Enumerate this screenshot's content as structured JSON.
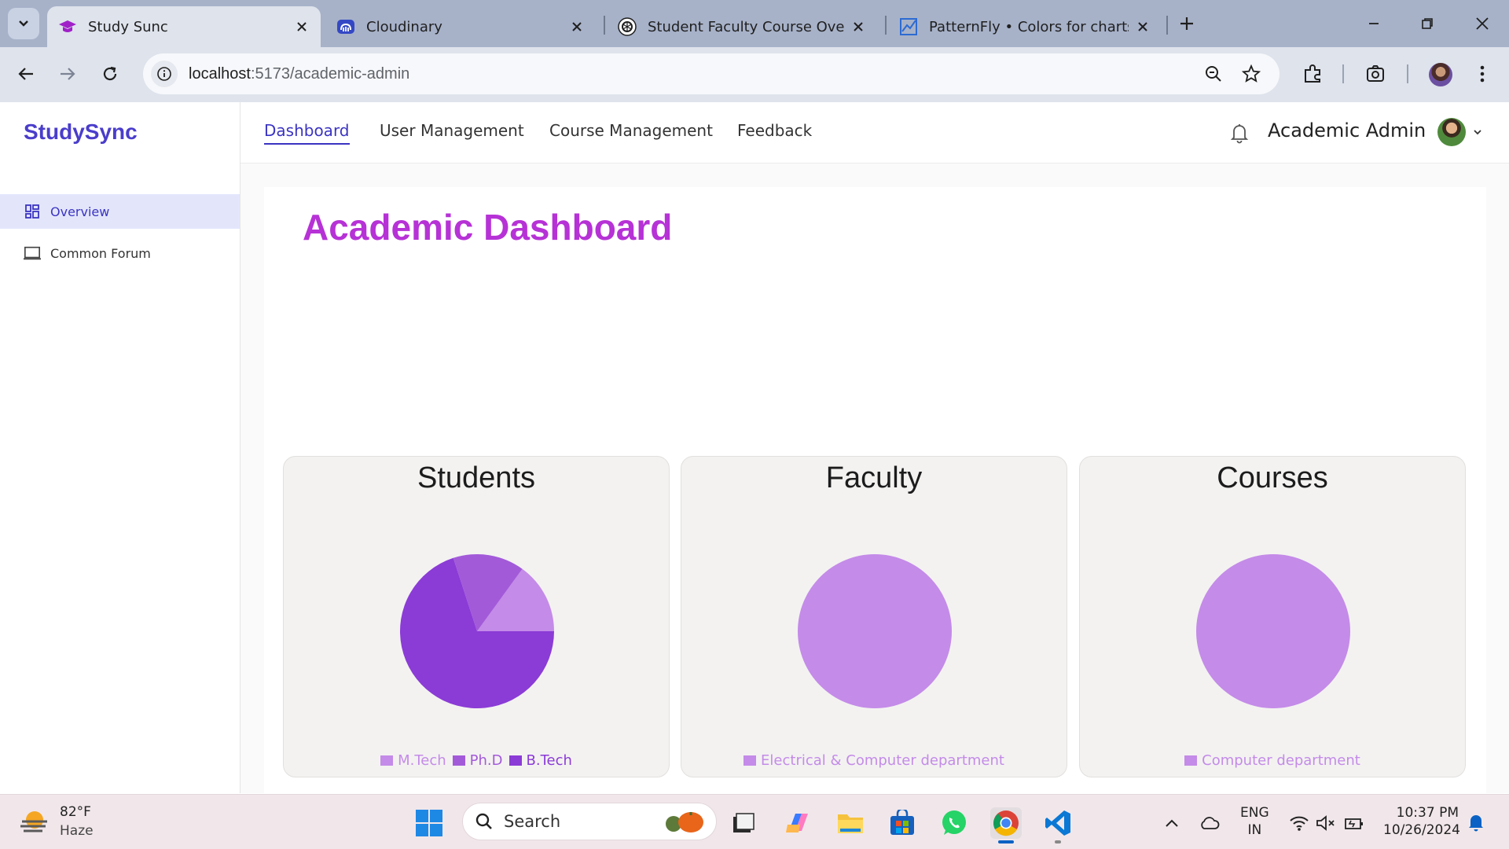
{
  "browser": {
    "tabs": [
      {
        "title": "Study Sunc",
        "active": true
      },
      {
        "title": "Cloudinary",
        "active": false
      },
      {
        "title": "Student Faculty Course Overview",
        "active": false
      },
      {
        "title": "PatternFly • Colors for charts",
        "active": false
      }
    ],
    "url_host": "localhost",
    "url_path": ":5173/academic-admin"
  },
  "app": {
    "brand": "StudySync",
    "sidebar": {
      "items": [
        {
          "label": "Overview",
          "icon": "dashboard-grid-icon",
          "active": true
        },
        {
          "label": "Common Forum",
          "icon": "laptop-icon",
          "active": false
        }
      ]
    },
    "topnav": {
      "links": [
        {
          "label": "Dashboard",
          "active": true
        },
        {
          "label": "User Management",
          "active": false
        },
        {
          "label": "Course Management",
          "active": false
        },
        {
          "label": "Feedback",
          "active": false
        }
      ],
      "user_name": "Academic Admin"
    },
    "page_title": "Academic Dashboard",
    "colors": {
      "brand": "#4a3dcb",
      "title": "#b632d6",
      "slice_light": "#c48be8",
      "slice_mid": "#a35ad9",
      "slice_dark": "#8b3bd6"
    }
  },
  "chart_data": [
    {
      "type": "pie",
      "title": "Students",
      "categories": [
        "M.Tech",
        "Ph.D",
        "B.Tech"
      ],
      "values": [
        15,
        15,
        70
      ],
      "colors": [
        "#c48be8",
        "#a35ad9",
        "#8b3bd6"
      ],
      "legend": "bottom"
    },
    {
      "type": "pie",
      "title": "Faculty",
      "categories": [
        "Electrical & Computer department"
      ],
      "values": [
        100
      ],
      "colors": [
        "#c48be8"
      ],
      "legend": "bottom"
    },
    {
      "type": "pie",
      "title": "Courses",
      "categories": [
        "Computer department"
      ],
      "values": [
        100
      ],
      "colors": [
        "#c48be8"
      ],
      "legend": "bottom"
    }
  ],
  "taskbar": {
    "weather_temp": "82°F",
    "weather_desc": "Haze",
    "search_placeholder": "Search",
    "lang_line1": "ENG",
    "lang_line2": "IN",
    "time": "10:37 PM",
    "date": "10/26/2024",
    "apps": [
      "file-explorer-icon",
      "copilot-icon",
      "folder-icon",
      "store-icon",
      "whatsapp-icon",
      "chrome-icon",
      "vscode-icon"
    ]
  }
}
